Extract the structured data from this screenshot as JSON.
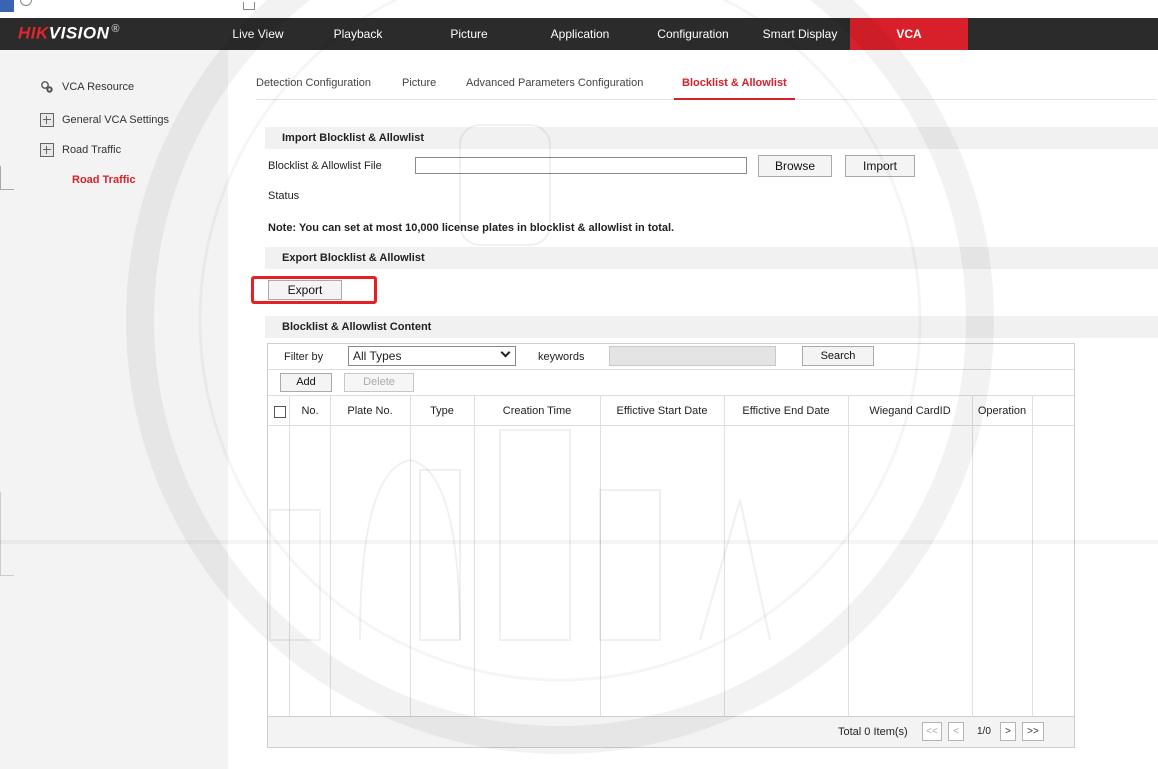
{
  "header": {
    "logo_hik": "HIK",
    "logo_vision": "VISION",
    "logo_reg": "®",
    "nav": [
      {
        "label": "Live View"
      },
      {
        "label": "Playback"
      },
      {
        "label": "Picture"
      },
      {
        "label": "Application"
      },
      {
        "label": "Configuration"
      },
      {
        "label": "Smart Display"
      },
      {
        "label": "VCA",
        "active": true
      }
    ]
  },
  "sidebar": {
    "items": [
      {
        "label": "VCA Resource",
        "icon": "vca-resource-icon"
      },
      {
        "label": "General VCA Settings",
        "icon": "grid-icon"
      },
      {
        "label": "Road Traffic",
        "icon": "grid-icon"
      },
      {
        "label": "Road Traffic",
        "selected": true
      }
    ]
  },
  "tabs": [
    {
      "label": "Detection Configuration"
    },
    {
      "label": "Picture"
    },
    {
      "label": "Advanced Parameters Configuration"
    },
    {
      "label": "Blocklist & Allowlist",
      "active": true
    }
  ],
  "import_section": {
    "title": "Import Blocklist & Allowlist",
    "file_label": "Blocklist & Allowlist File",
    "file_value": "",
    "browse_label": "Browse",
    "import_label": "Import",
    "status_label": "Status",
    "note": "Note: You can set at most 10,000 license plates in blocklist & allowlist in total."
  },
  "export_section": {
    "title": "Export Blocklist & Allowlist",
    "export_label": "Export"
  },
  "content_section": {
    "title": "Blocklist & Allowlist Content",
    "filter_label": "Filter by",
    "filter_value": "All Types",
    "keywords_label": "keywords",
    "keywords_value": "",
    "search_label": "Search",
    "add_label": "Add",
    "delete_label": "Delete",
    "columns": [
      "No.",
      "Plate No.",
      "Type",
      "Creation Time",
      "Effictive Start Date",
      "Effictive End Date",
      "Wiegand CardID",
      "Operation"
    ],
    "rows": [],
    "total_label": "Total 0 Item(s)",
    "pager": {
      "first": "<<",
      "prev": "<",
      "page": "1/0",
      "next": ">",
      "last": ">>"
    }
  },
  "colors": {
    "accent_red": "#d8202a",
    "header_bg": "#2b2b2b",
    "highlight_box": "#e81e25"
  }
}
